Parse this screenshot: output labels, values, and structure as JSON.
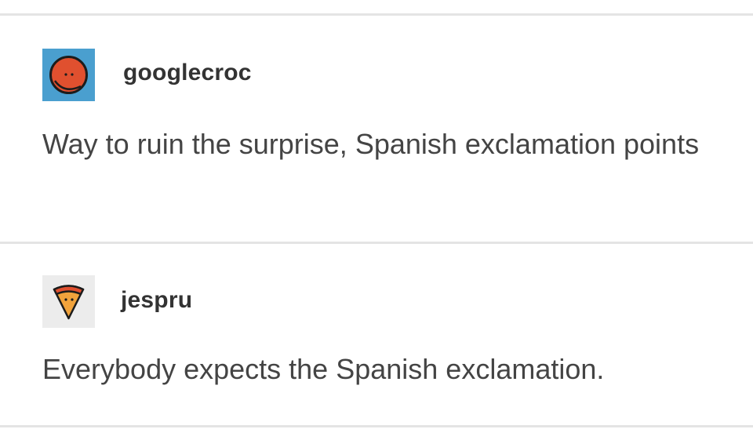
{
  "posts": [
    {
      "username": "googlecroc",
      "avatar_icon": "red-face-circle-icon",
      "avatar_bg": "#4a9fcf",
      "text": "Way to ruin the surprise, Spanish exclamation points"
    },
    {
      "username": "jespru",
      "avatar_icon": "pizza-slice-icon",
      "avatar_bg": "#ececec",
      "text": "Everybody expects the Spanish exclamation."
    }
  ]
}
